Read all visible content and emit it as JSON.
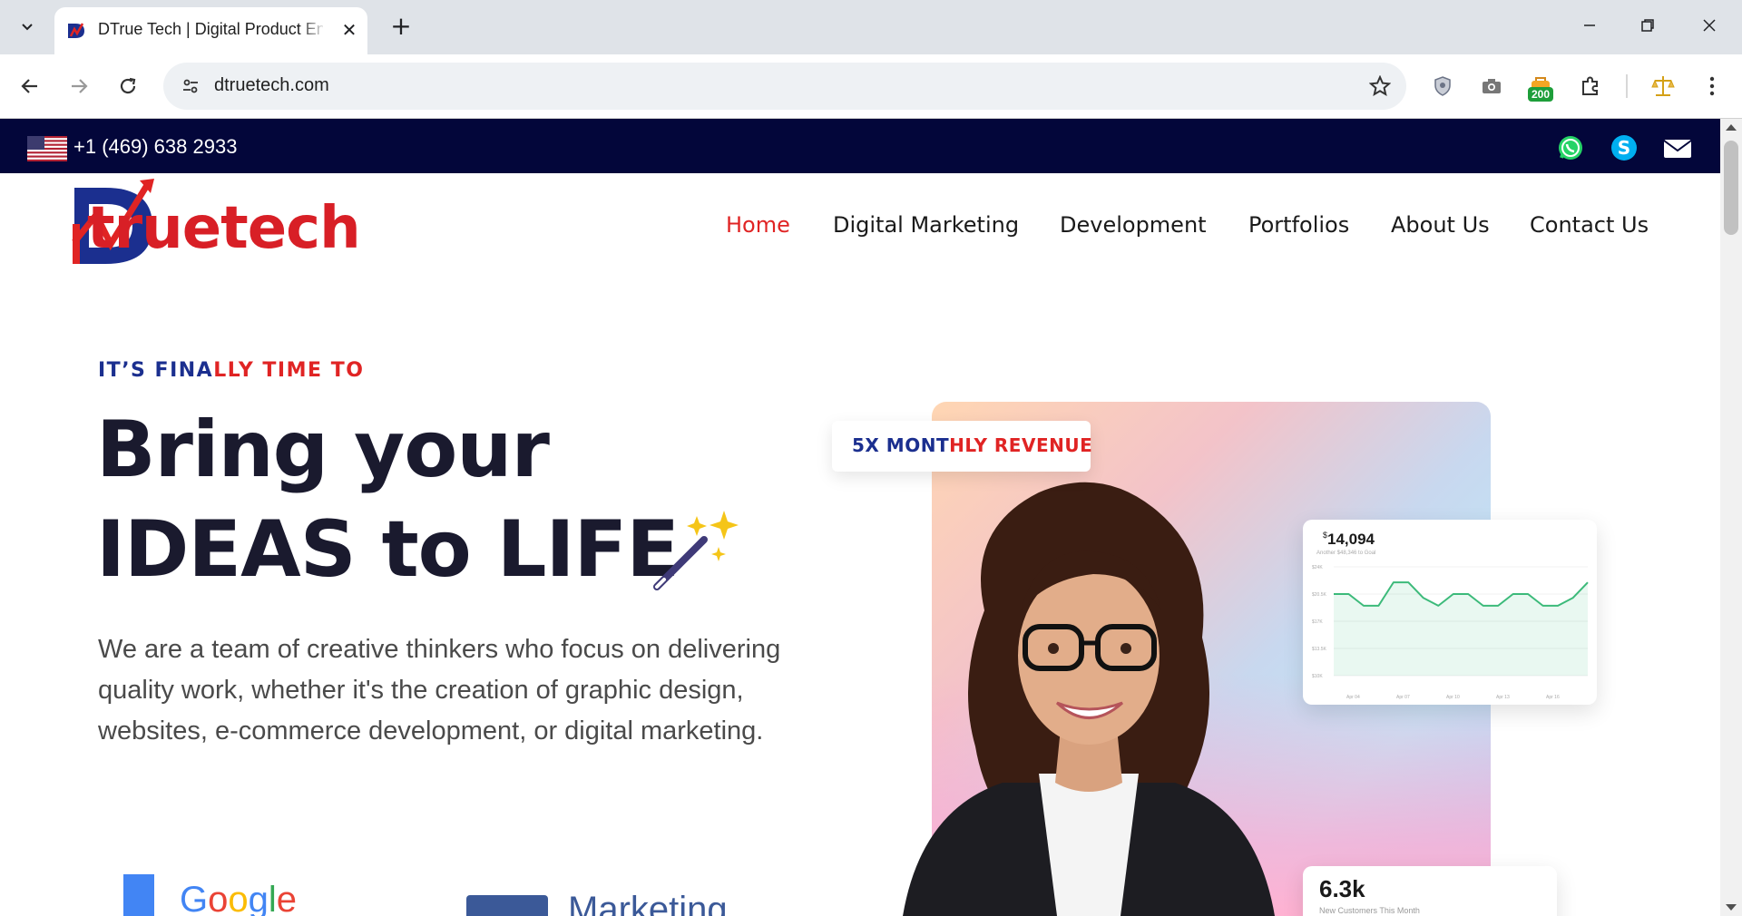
{
  "browser": {
    "tab_title": "DTrue Tech | Digital Product Engineering",
    "url": "dtruetech.com",
    "extension_badge": "200"
  },
  "topbar": {
    "phone": "+1 (469) 638 2933",
    "icons": [
      "us-flag",
      "whatsapp-icon",
      "skype-icon",
      "mail-icon"
    ]
  },
  "brand": {
    "logo_letter": "D",
    "logo_rest": "truetech",
    "colors": {
      "red": "#e02424",
      "navy": "#1b2f8f",
      "topbar": "#03063a"
    }
  },
  "nav": {
    "items": [
      "Home",
      "Digital Marketing",
      "Development",
      "Portfolios",
      "About Us",
      "Contact Us"
    ],
    "active": "Home"
  },
  "hero": {
    "eyebrow_blue": "IT’S FINA",
    "eyebrow_red": "LLY TIME TO",
    "line1": "Bring your",
    "line2": "IDEAS to LIFE",
    "description": "We are a team of creative thinkers who focus on delivering quality work, whether it's the creation of graphic design, websites, e-commerce development, or digital marketing."
  },
  "revenue_chip": {
    "blue": "5X MONT",
    "red": "HLY REVENUE"
  },
  "stats_card": {
    "value": "14,094",
    "currency": "$",
    "subtitle": "Another $48,346 to Goal"
  },
  "chart_data": {
    "type": "line",
    "title": "",
    "x_labels": [
      "Apr 04",
      "Apr 07",
      "Apr 10",
      "Apr 13",
      "Apr 16"
    ],
    "y_ticks": [
      "$10K",
      "$13.5K",
      "$17K",
      "$20.5K",
      "$24K"
    ],
    "series": [
      {
        "values": [
          20.5,
          20.5,
          19.0,
          19.0,
          22.0,
          22.0,
          20.0,
          19.0,
          20.5,
          20.5,
          19.0,
          19.0,
          20.5,
          20.5,
          19.0,
          19.0,
          20.0,
          22.0
        ]
      }
    ],
    "ylim": [
      10,
      24
    ],
    "grid": true
  },
  "visit_card": {
    "value": "6.3k",
    "subtitle": "New Customers This Month"
  },
  "partners": {
    "google": "Google",
    "facebook": "Marketing"
  }
}
